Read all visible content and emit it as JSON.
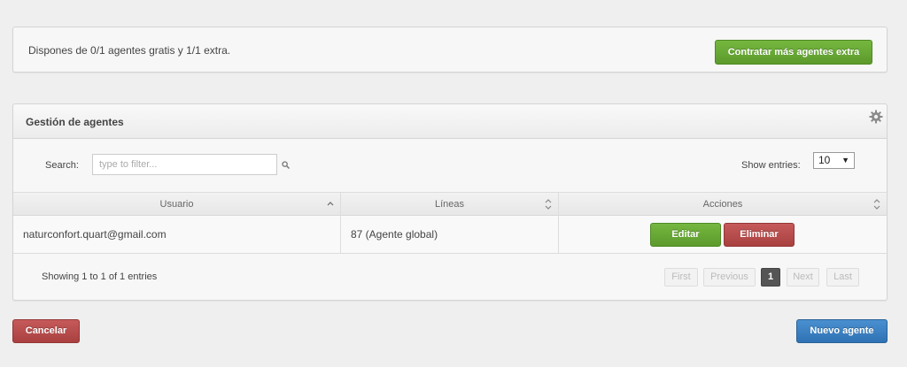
{
  "info": {
    "text": "Dispones de 0/1 agentes gratis y 1/1 extra.",
    "contract_button": "Contratar más agentes extra"
  },
  "agents_panel": {
    "title": "Gestión de agentes",
    "settings_icon": "gear-icon"
  },
  "search": {
    "label": "Search:",
    "placeholder": "type to filter..."
  },
  "entries": {
    "label": "Show entries:",
    "selected": "10"
  },
  "table": {
    "headers": [
      "Usuario",
      "Líneas",
      "Acciones"
    ],
    "rows": [
      {
        "usuario": "naturconfort.quart@gmail.com",
        "lineas": "87 (Agente global)",
        "edit_label": "Editar",
        "delete_label": "Eliminar"
      }
    ]
  },
  "footer": {
    "showing": "Showing 1 to 1 of 1 entries",
    "pagination": {
      "first": "First",
      "previous": "Previous",
      "current": "1",
      "next": "Next",
      "last": "Last"
    }
  },
  "actions": {
    "cancel": "Cancelar",
    "new_agent": "Nuevo agente"
  },
  "colors": {
    "green": "#6aab35",
    "red": "#b64b4b",
    "blue": "#3a80c2"
  }
}
